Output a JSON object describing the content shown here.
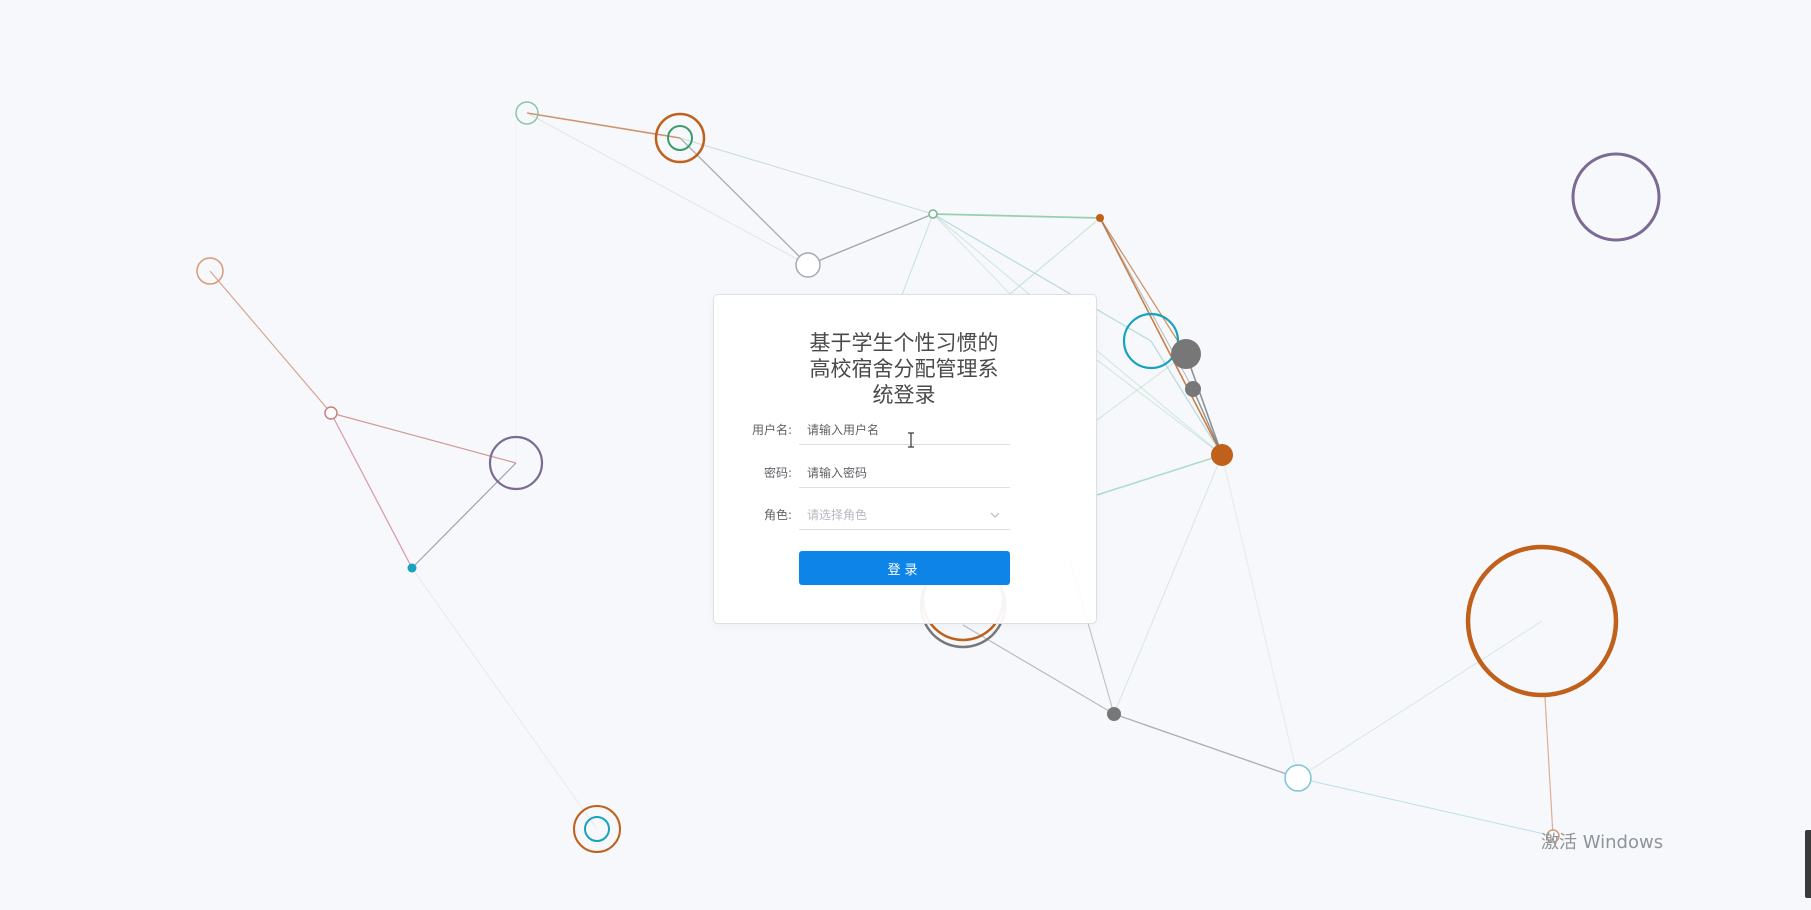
{
  "login": {
    "title": "基于学生个性习惯的高校宿舍分配管理系统登录",
    "username_label": "用户名:",
    "username_placeholder": "请输入用户名",
    "password_label": "密码:",
    "password_placeholder": "请输入密码",
    "role_label": "角色:",
    "role_placeholder": "请选择角色",
    "submit_label": "登录"
  },
  "watermark": {
    "text": "激活 Windows"
  },
  "icons": {
    "role_dropdown": "chevron-down-icon",
    "mouse_cursor": "text-cursor-icon"
  },
  "colors": {
    "background": "#f6f8fb",
    "primary": "#0d84e8",
    "network_orange": "#c0601a",
    "network_cyan": "#17a2c0",
    "network_gray": "#777777",
    "network_purple": "#7b6a94",
    "network_green": "#5aa97a"
  }
}
